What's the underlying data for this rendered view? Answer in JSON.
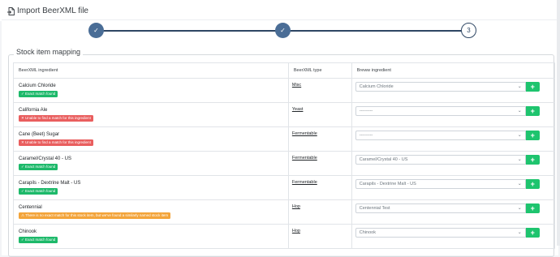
{
  "header": {
    "title": "Import BeerXML file",
    "icon": "file-import-icon"
  },
  "stepper": {
    "steps": [
      {
        "label": "✓",
        "state": "done"
      },
      {
        "label": "✓",
        "state": "done"
      },
      {
        "label": "3",
        "state": "current"
      }
    ]
  },
  "mapping": {
    "legend": "Stock item mapping",
    "columns": {
      "ingredient": "BeerXML ingredient",
      "type": "BeerXML type",
      "brew": "Breww ingredient"
    },
    "rows": [
      {
        "name": "Calcium Chloride",
        "badge": "✓ Exact match found",
        "status": "success",
        "type": "Misc",
        "selected": "Calcium Chloride"
      },
      {
        "name": "California Ale",
        "badge": "✕ Unable to find a match for this ingredient",
        "status": "danger",
        "type": "Yeast",
        "selected": "---------"
      },
      {
        "name": "Cane (Beet) Sugar",
        "badge": "✕ Unable to find a match for this ingredient",
        "status": "danger",
        "type": "Fermentable",
        "selected": "---------"
      },
      {
        "name": "Caramel/Crystal 40 - US",
        "badge": "✓ Exact match found",
        "status": "success",
        "type": "Fermentable",
        "selected": "Caramel/Crystal 40 - US"
      },
      {
        "name": "Carapils - Dextrine Malt - US",
        "badge": "✓ Exact match found",
        "status": "success",
        "type": "Fermentable",
        "selected": "Carapils - Dextrine Malt - US"
      },
      {
        "name": "Centennial",
        "badge": "⚠ There is no exact match for this stock item, but we've found a similarly named stock item",
        "status": "warning",
        "type": "Hop",
        "selected": "Centennial Test"
      },
      {
        "name": "Chinook",
        "badge": "✓ Exact match found",
        "status": "success",
        "type": "Hop",
        "selected": "Chinook"
      }
    ],
    "add_label": "+",
    "chevron": "⌄"
  },
  "colors": {
    "accent": "#2e4663",
    "step_done": "#4a6d96",
    "success": "#1db96a",
    "danger": "#e95e5e",
    "warning": "#f3a43a",
    "add_button": "#1ec46e"
  }
}
